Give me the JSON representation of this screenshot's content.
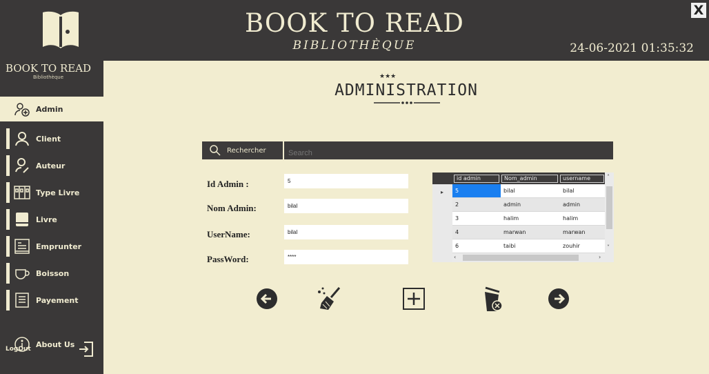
{
  "header": {
    "title": "BOOK TO READ",
    "subtitle": "BIBLIOTHÈQUE",
    "datetime": "24-06-2021 01:35:32",
    "close_label": "X"
  },
  "sidebar": {
    "brand": "BOOK TO READ",
    "brand_sub": "Bibliothèque",
    "items": [
      {
        "label": "Admin",
        "icon": "admin-add-icon",
        "active": true
      },
      {
        "label": "Client",
        "icon": "user-icon"
      },
      {
        "label": "Auteur",
        "icon": "author-icon"
      },
      {
        "label": "Type Livre",
        "icon": "bookshelf-icon"
      },
      {
        "label": "Livre",
        "icon": "book-icon"
      },
      {
        "label": "Emprunter",
        "icon": "borrow-icon"
      },
      {
        "label": "Boisson",
        "icon": "cup-icon"
      },
      {
        "label": "Payement",
        "icon": "receipt-icon"
      },
      {
        "label": "About Us",
        "icon": "info-icon"
      }
    ],
    "logout_label": "LogOut"
  },
  "main": {
    "title": "ADMINISTRATION",
    "stars": "★★★",
    "search": {
      "button_label": "Rechercher",
      "placeholder": "Search"
    },
    "form": {
      "id_label": "Id Admin :",
      "id_value": "5",
      "nom_label": "Nom Admin:",
      "nom_value": "bilal",
      "username_label": "UserName:",
      "username_value": "bilal",
      "password_label": "PassWord:",
      "password_value": "****"
    },
    "grid": {
      "columns": [
        "id admin",
        "Nom_admin",
        "username"
      ],
      "rows": [
        [
          "5",
          "bilal",
          "bilal"
        ],
        [
          "2",
          "admin",
          "admin"
        ],
        [
          "3",
          "halim",
          "halim"
        ],
        [
          "4",
          "marwan",
          "marwan"
        ],
        [
          "6",
          "taibi",
          "zouhir"
        ]
      ],
      "selected_row": 0
    },
    "actions": [
      "back-arrow-icon",
      "clear-broom-icon",
      "add-plus-icon",
      "delete-bin-icon",
      "next-arrow-icon"
    ]
  },
  "colors": {
    "dark": "#3a3838",
    "cream": "#f2edd0",
    "select_blue": "#1a7ff0"
  }
}
